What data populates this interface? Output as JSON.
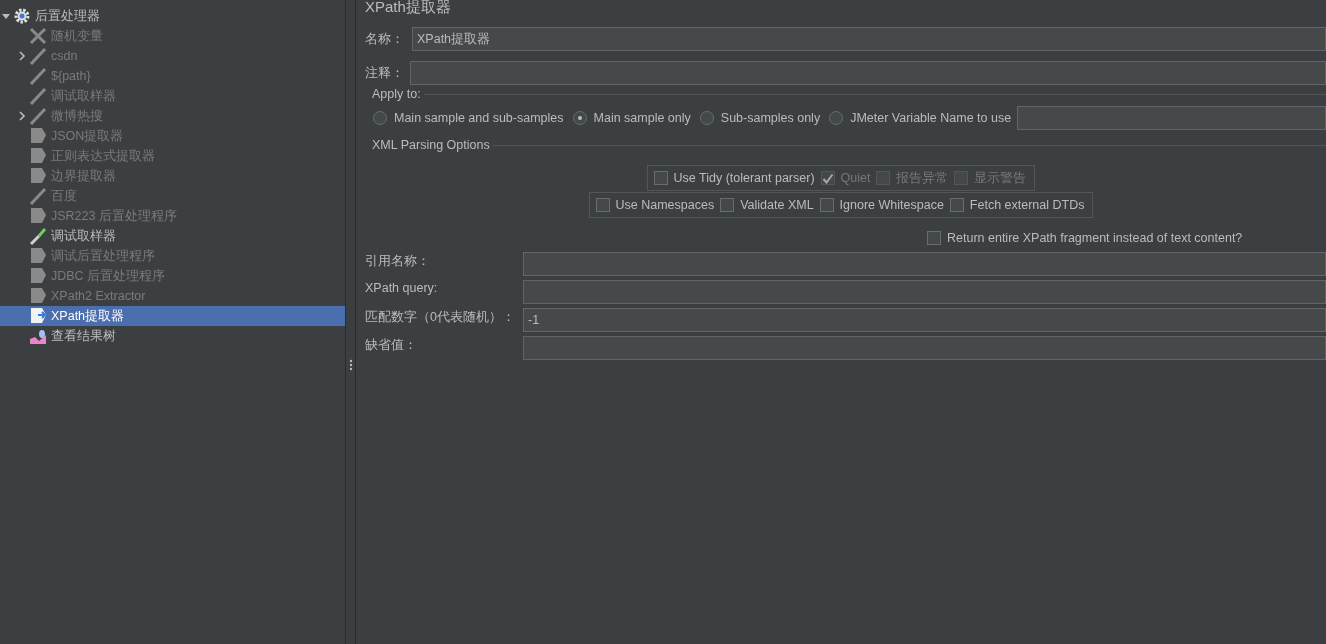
{
  "tree": {
    "root": {
      "label": "后置处理器",
      "expanded": true,
      "selected": false,
      "children": [
        {
          "label": "随机变量",
          "kind": "config",
          "disabled": true,
          "expandable": false,
          "selected": false
        },
        {
          "label": "csdn",
          "kind": "sampler",
          "disabled": true,
          "expandable": true,
          "selected": false
        },
        {
          "label": "${path}",
          "kind": "sampler",
          "disabled": true,
          "expandable": false,
          "selected": false
        },
        {
          "label": "调试取样器",
          "kind": "sampler",
          "disabled": true,
          "expandable": false,
          "selected": false
        },
        {
          "label": "微博热搜",
          "kind": "sampler",
          "disabled": true,
          "expandable": true,
          "selected": false
        },
        {
          "label": "JSON提取器",
          "kind": "extractor",
          "disabled": true,
          "expandable": false,
          "selected": false
        },
        {
          "label": "正则表达式提取器",
          "kind": "extractor",
          "disabled": true,
          "expandable": false,
          "selected": false
        },
        {
          "label": "边界提取器",
          "kind": "extractor",
          "disabled": true,
          "expandable": false,
          "selected": false
        },
        {
          "label": "百度",
          "kind": "sampler",
          "disabled": true,
          "expandable": false,
          "selected": false
        },
        {
          "label": "JSR223 后置处理程序",
          "kind": "extractor",
          "disabled": true,
          "expandable": false,
          "selected": false
        },
        {
          "label": "调试取样器",
          "kind": "sampler",
          "disabled": false,
          "expandable": false,
          "selected": false
        },
        {
          "label": "调试后置处理程序",
          "kind": "extractor",
          "disabled": true,
          "expandable": false,
          "selected": false
        },
        {
          "label": "JDBC 后置处理程序",
          "kind": "extractor",
          "disabled": true,
          "expandable": false,
          "selected": false
        },
        {
          "label": "XPath2 Extractor",
          "kind": "extractor",
          "disabled": true,
          "expandable": false,
          "selected": false
        },
        {
          "label": "XPath提取器",
          "kind": "extractor",
          "disabled": false,
          "expandable": false,
          "selected": true
        },
        {
          "label": "查看结果树",
          "kind": "listener",
          "disabled": false,
          "expandable": false,
          "selected": false
        }
      ]
    }
  },
  "form": {
    "title": "XPath提取器",
    "name_field": {
      "label": "名称：",
      "value": "XPath提取器"
    },
    "comment_field": {
      "label": "注释："
    },
    "apply_to": {
      "legend": "Apply to:",
      "options": [
        {
          "label": "Main sample and sub-samples",
          "selected": false
        },
        {
          "label": "Main sample only",
          "selected": true
        },
        {
          "label": "Sub-samples only",
          "selected": false
        },
        {
          "label": "JMeter Variable Name to use",
          "selected": false
        }
      ]
    },
    "xml_options": {
      "legend": "XML Parsing Options",
      "tidy_group": [
        {
          "label": "Use Tidy (tolerant parser)",
          "checked": false,
          "disabled": false
        },
        {
          "label": "Quiet",
          "checked": true,
          "disabled": true
        },
        {
          "label": "报告异常",
          "checked": false,
          "disabled": true
        },
        {
          "label": "显示警告",
          "checked": false,
          "disabled": true
        }
      ],
      "parser_group": [
        {
          "label": "Use Namespaces",
          "checked": false,
          "disabled": false
        },
        {
          "label": "Validate XML",
          "checked": false,
          "disabled": false
        },
        {
          "label": "Ignore Whitespace",
          "checked": false,
          "disabled": false
        },
        {
          "label": "Fetch external DTDs",
          "checked": false,
          "disabled": false
        }
      ],
      "return_fragment": {
        "label": "Return entire XPath fragment instead of text content?",
        "checked": false,
        "disabled": false
      }
    },
    "fields": [
      {
        "label": "引用名称："
      },
      {
        "label": "XPath query:"
      },
      {
        "label": "匹配数字（0代表随机）：",
        "value": "-1"
      },
      {
        "label": "缺省值："
      }
    ]
  }
}
